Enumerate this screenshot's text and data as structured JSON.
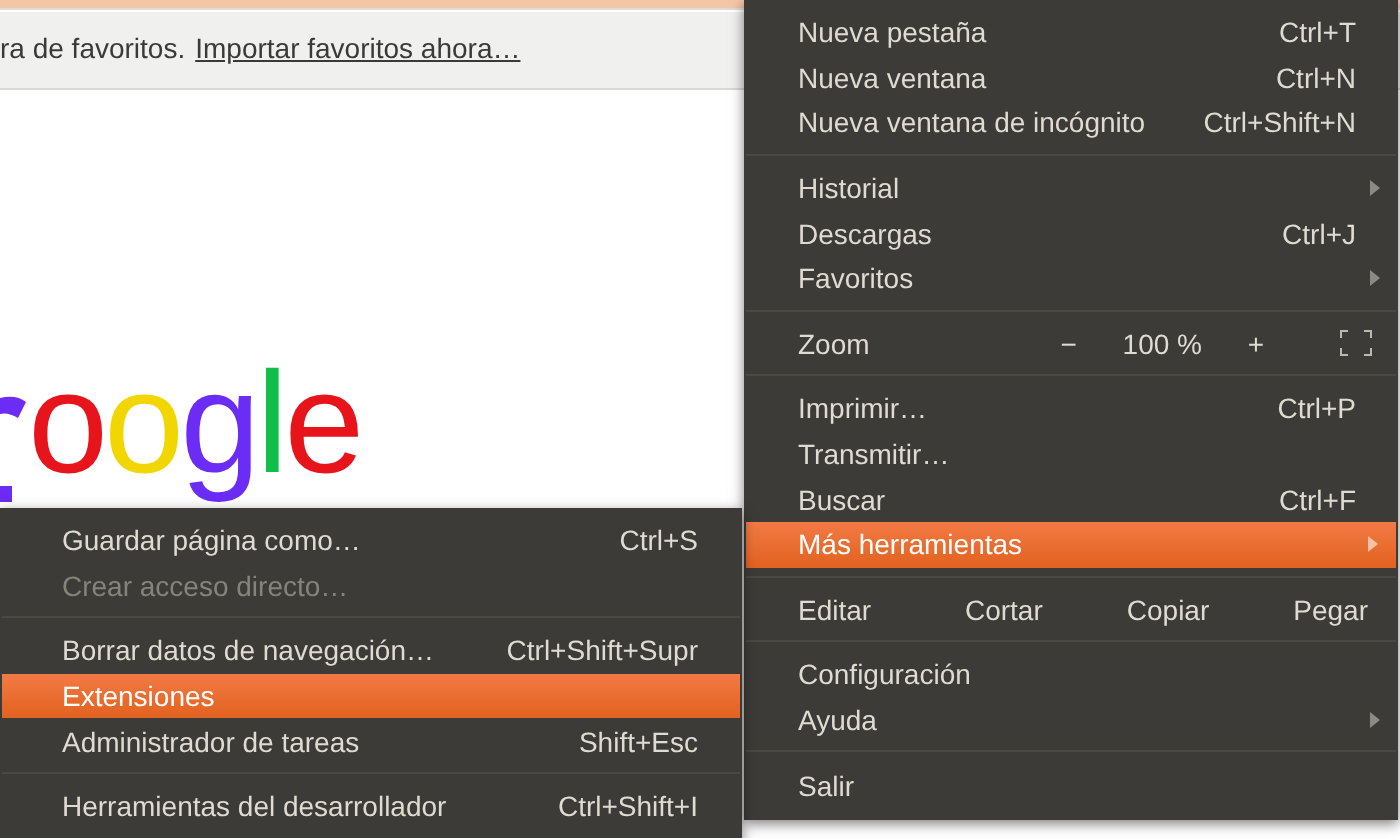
{
  "bookmark_bar": {
    "text": "ra de favoritos.",
    "link": "Importar favoritos ahora…"
  },
  "logo": {
    "letters": [
      {
        "char": "o",
        "color": "#e8141c"
      },
      {
        "char": "o",
        "color": "#f2d600"
      },
      {
        "char": "g",
        "color": "#6b2cf5"
      },
      {
        "char": "l",
        "color": "#0fbf4a"
      },
      {
        "char": "e",
        "color": "#e8141c"
      }
    ]
  },
  "main_menu": {
    "sections": [
      [
        {
          "kind": "item",
          "label": "Nueva pestaña",
          "shortcut": "Ctrl+T",
          "submenu": false,
          "selected": false
        },
        {
          "kind": "item",
          "label": "Nueva ventana",
          "shortcut": "Ctrl+N",
          "submenu": false,
          "selected": false
        },
        {
          "kind": "item",
          "label": "Nueva ventana de incógnito",
          "shortcut": "Ctrl+Shift+N",
          "submenu": false,
          "selected": false
        }
      ],
      [
        {
          "kind": "item",
          "label": "Historial",
          "submenu": true,
          "selected": false
        },
        {
          "kind": "item",
          "label": "Descargas",
          "shortcut": "Ctrl+J",
          "submenu": false,
          "selected": false
        },
        {
          "kind": "item",
          "label": "Favoritos",
          "submenu": true,
          "selected": false
        }
      ],
      [
        {
          "kind": "zoom",
          "label": "Zoom",
          "minus": "−",
          "value": "100 %",
          "plus": "+"
        }
      ],
      [
        {
          "kind": "item",
          "label": "Imprimir…",
          "shortcut": "Ctrl+P",
          "submenu": false,
          "selected": false
        },
        {
          "kind": "item",
          "label": "Transmitir…",
          "submenu": false,
          "selected": false
        },
        {
          "kind": "item",
          "label": "Buscar",
          "shortcut": "Ctrl+F",
          "submenu": false,
          "selected": false
        },
        {
          "kind": "item",
          "label": "Más herramientas",
          "submenu": true,
          "selected": true
        }
      ],
      [
        {
          "kind": "edit",
          "label": "Editar",
          "cut": "Cortar",
          "copy": "Copiar",
          "paste": "Pegar"
        }
      ],
      [
        {
          "kind": "item",
          "label": "Configuración",
          "submenu": false,
          "selected": false
        },
        {
          "kind": "item",
          "label": "Ayuda",
          "submenu": true,
          "selected": false
        }
      ],
      [
        {
          "kind": "item",
          "label": "Salir",
          "submenu": false,
          "selected": false
        }
      ]
    ]
  },
  "sub_menu": {
    "sections": [
      [
        {
          "label": "Guardar página como…",
          "shortcut": "Ctrl+S",
          "disabled": false,
          "selected": false
        },
        {
          "label": "Crear acceso directo…",
          "disabled": true,
          "selected": false
        }
      ],
      [
        {
          "label": "Borrar datos de navegación…",
          "shortcut": "Ctrl+Shift+Supr",
          "disabled": false,
          "selected": false
        },
        {
          "label": "Extensiones",
          "disabled": false,
          "selected": true
        },
        {
          "label": "Administrador de tareas",
          "shortcut": "Shift+Esc",
          "disabled": false,
          "selected": false
        }
      ],
      [
        {
          "label": "Herramientas del desarrollador",
          "shortcut": "Ctrl+Shift+I",
          "disabled": false,
          "selected": false
        }
      ]
    ]
  }
}
